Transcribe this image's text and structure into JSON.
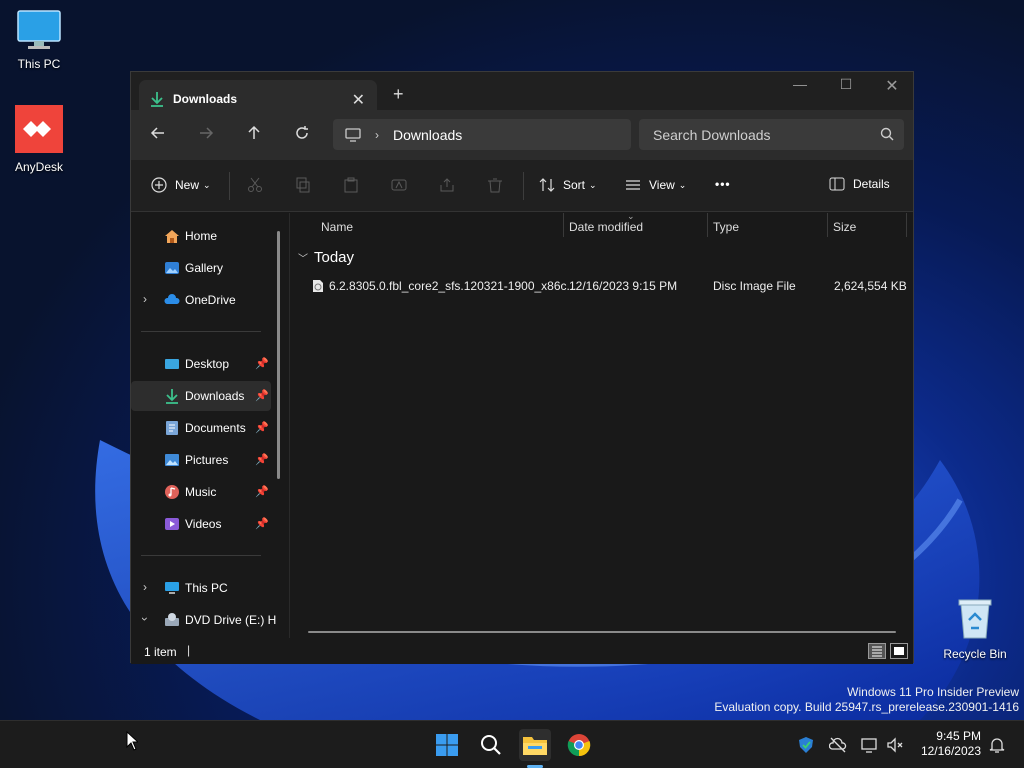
{
  "desktop": {
    "icons": [
      {
        "label": "This PC",
        "icon": "monitor-icon"
      },
      {
        "label": "AnyDesk",
        "icon": "anydesk-icon"
      },
      {
        "label": "Recycle Bin",
        "icon": "recycle-bin-icon"
      }
    ],
    "watermark": {
      "line1": "Windows 11 Pro Insider Preview",
      "line2": "Evaluation copy. Build 25947.rs_prerelease.230901-1416"
    }
  },
  "window": {
    "tab_title": "Downloads",
    "tab_close": "✕",
    "new_tab": "+",
    "controls": {
      "minimize": "—",
      "maximize": "☐",
      "close": "✕"
    },
    "address": {
      "location_icon": "monitor-icon",
      "separator": "›",
      "path": "Downloads"
    },
    "search": {
      "placeholder": "Search Downloads"
    },
    "commands": {
      "new_label": "New",
      "sort_label": "Sort",
      "view_label": "View",
      "more_label": "•••",
      "details_label": "Details"
    },
    "sidebar": {
      "items": [
        {
          "label": "Home",
          "icon": "home-icon"
        },
        {
          "label": "Gallery",
          "icon": "gallery-icon"
        },
        {
          "label": "OneDrive",
          "icon": "cloud-icon"
        },
        {
          "label": "Desktop",
          "icon": "desktop-folder-icon"
        },
        {
          "label": "Downloads",
          "icon": "download-icon"
        },
        {
          "label": "Documents",
          "icon": "documents-icon"
        },
        {
          "label": "Pictures",
          "icon": "pictures-icon"
        },
        {
          "label": "Music",
          "icon": "music-icon"
        },
        {
          "label": "Videos",
          "icon": "videos-icon"
        },
        {
          "label": "This PC",
          "icon": "monitor-icon"
        },
        {
          "label": "DVD Drive (E:) H",
          "icon": "dvd-drive-icon"
        }
      ],
      "selected": "Downloads"
    },
    "columns": {
      "name": "Name",
      "date": "Date modified",
      "type": "Type",
      "size": "Size"
    },
    "groups": [
      {
        "label": "Today",
        "files": [
          {
            "name": "6.2.8305.0.fbl_core2_sfs.120321-1900_x86c...",
            "date": "12/16/2023 9:15 PM",
            "type": "Disc Image File",
            "size": "2,624,554 KB",
            "icon": "disc-image-icon"
          }
        ]
      }
    ],
    "status": {
      "count": "1 item"
    }
  },
  "taskbar": {
    "apps": [
      {
        "name": "Start",
        "icon": "windows-logo-icon"
      },
      {
        "name": "Search",
        "icon": "search-icon"
      },
      {
        "name": "File Explorer",
        "icon": "folder-icon",
        "active": true
      },
      {
        "name": "Chrome",
        "icon": "chrome-icon"
      }
    ],
    "clock": {
      "time": "9:45 PM",
      "date": "12/16/2023"
    }
  },
  "colors": {
    "accent": "#5fb2f2",
    "window_bg": "#191919",
    "anydesk_red": "#ef443b"
  }
}
